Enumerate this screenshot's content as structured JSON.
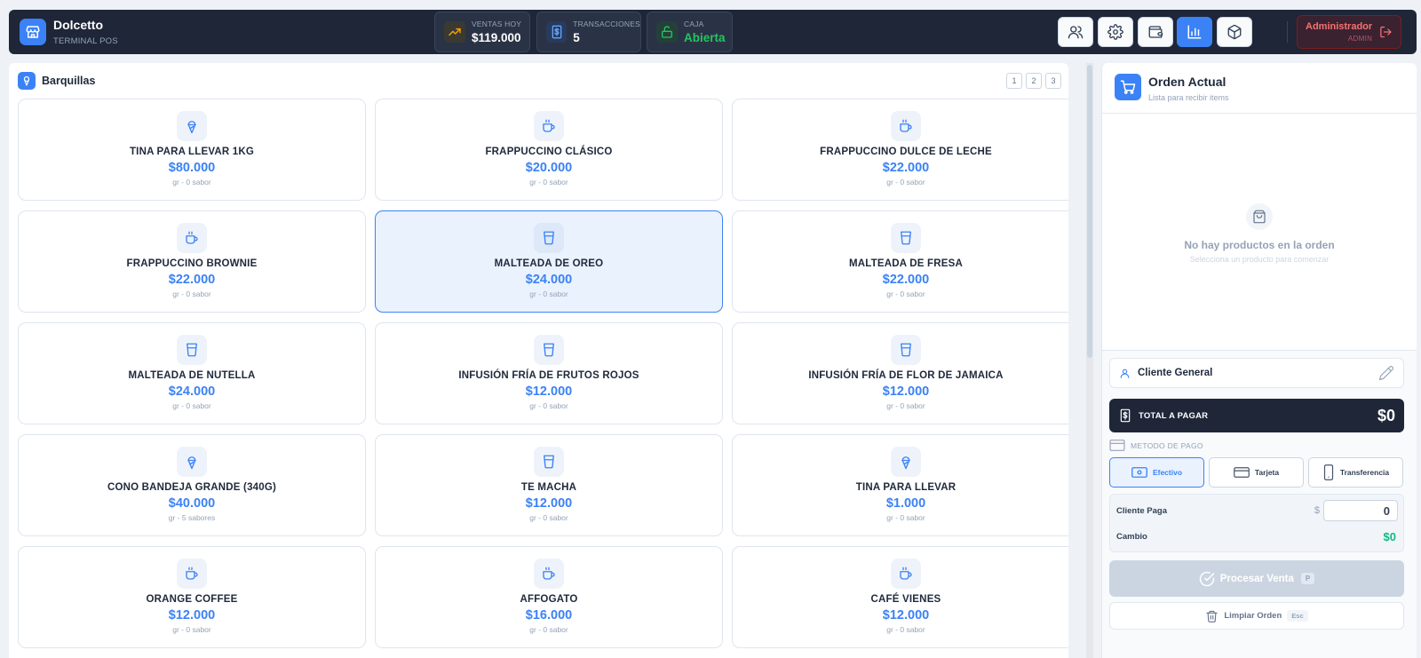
{
  "header": {
    "brand_name": "Dolcetto",
    "brand_subtitle": "TERMINAL POS",
    "stats": [
      {
        "label": "VENTAS HOY",
        "value": "$119.000"
      },
      {
        "label": "TRANSACCIONES",
        "value": "5"
      },
      {
        "label": "CAJA",
        "value": "Abierta"
      }
    ],
    "admin_name": "Administrador",
    "admin_role": "ADMIN"
  },
  "category": {
    "title": "Barquillas",
    "pages": [
      "1",
      "2",
      "3"
    ]
  },
  "products": [
    {
      "name": "TINA PARA LLEVAR 1KG",
      "price": "$80.000",
      "meta": "gr - 0 sabor",
      "icon": "ice-cream-icon"
    },
    {
      "name": "FRAPPUCCINO CLÁSICO",
      "price": "$20.000",
      "meta": "gr - 0 sabor",
      "icon": "coffee-cup-icon"
    },
    {
      "name": "FRAPPUCCINO DULCE DE LECHE",
      "price": "$22.000",
      "meta": "gr - 0 sabor",
      "icon": "coffee-cup-icon"
    },
    {
      "name": "FRAPPUCCINO BROWNIE",
      "price": "$22.000",
      "meta": "gr - 0 sabor",
      "icon": "coffee-cup-icon"
    },
    {
      "name": "MALTEADA DE OREO",
      "price": "$24.000",
      "meta": "gr - 0 sabor",
      "icon": "glass-icon"
    },
    {
      "name": "MALTEADA DE FRESA",
      "price": "$22.000",
      "meta": "gr - 0 sabor",
      "icon": "glass-icon"
    },
    {
      "name": "MALTEADA DE NUTELLA",
      "price": "$24.000",
      "meta": "gr - 0 sabor",
      "icon": "glass-icon"
    },
    {
      "name": "INFUSIÓN FRÍA DE FRUTOS ROJOS",
      "price": "$12.000",
      "meta": "gr - 0 sabor",
      "icon": "glass-icon"
    },
    {
      "name": "INFUSIÓN FRÍA DE FLOR DE JAMAICA",
      "price": "$12.000",
      "meta": "gr - 0 sabor",
      "icon": "glass-icon"
    },
    {
      "name": "CONO BANDEJA GRANDE (340G)",
      "price": "$40.000",
      "meta": "gr - 5 sabores",
      "icon": "ice-cream-icon"
    },
    {
      "name": "TE MACHA",
      "price": "$12.000",
      "meta": "gr - 0 sabor",
      "icon": "glass-icon"
    },
    {
      "name": "TINA PARA LLEVAR",
      "price": "$1.000",
      "meta": "gr - 0 sabor",
      "icon": "ice-cream-icon"
    },
    {
      "name": "ORANGE COFFEE",
      "price": "$12.000",
      "meta": "gr - 0 sabor",
      "icon": "coffee-cup-icon"
    },
    {
      "name": "AFFOGATO",
      "price": "$16.000",
      "meta": "gr - 0 sabor",
      "icon": "coffee-cup-icon"
    },
    {
      "name": "CAFÉ VIENES",
      "price": "$12.000",
      "meta": "gr - 0 sabor",
      "icon": "coffee-cup-icon"
    }
  ],
  "order": {
    "title": "Orden Actual",
    "subtitle": "Lista para recibir items",
    "empty_title": "No hay productos en la orden",
    "empty_subtitle": "Selecciona un producto para comenzar",
    "client_label": "Cliente General",
    "total_label": "TOTAL A PAGAR",
    "total_value": "$0",
    "payment_method_label": "METODO DE PAGO",
    "payment_methods": [
      "Efectivo",
      "Tarjeta",
      "Transferencia"
    ],
    "client_pays_label": "Cliente Paga",
    "currency_symbol": "$",
    "client_pays_value": "0",
    "change_label": "Cambio",
    "change_value": "$0",
    "process_label": "Procesar Venta",
    "process_shortcut": "P",
    "clear_label": "Limpiar Orden",
    "clear_shortcut": "Esc"
  },
  "colors": {
    "accent": "#3b82f6",
    "header_bg": "#1e2638",
    "success": "#22c55e",
    "danger": "#f87171"
  }
}
